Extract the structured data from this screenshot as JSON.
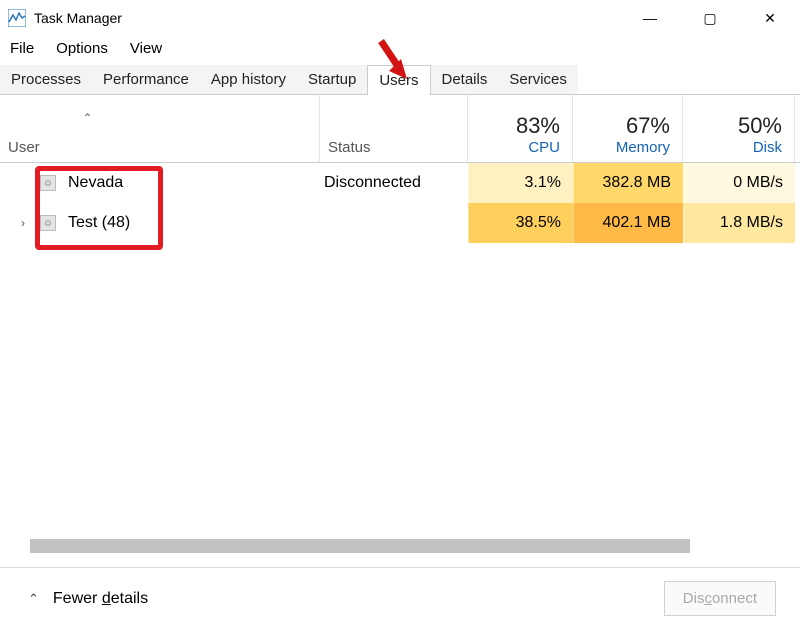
{
  "title": "Task Manager",
  "window_buttons": {
    "min": "—",
    "max": "▢",
    "close": "✕"
  },
  "menu": [
    "File",
    "Options",
    "View"
  ],
  "tabs": [
    "Processes",
    "Performance",
    "App history",
    "Startup",
    "Users",
    "Details",
    "Services"
  ],
  "active_tab": "Users",
  "columns": {
    "user": "User",
    "status": "Status",
    "cpu": {
      "percent": "83%",
      "label": "CPU"
    },
    "memory": {
      "percent": "67%",
      "label": "Memory"
    },
    "disk": {
      "percent": "50%",
      "label": "Disk"
    }
  },
  "rows": [
    {
      "expand": "",
      "name": "Nevada",
      "status": "Disconnected",
      "cpu": "3.1%",
      "memory": "382.8 MB",
      "disk": "0 MB/s",
      "cpu_class": "hc-y1",
      "mem_class": "hc-y2",
      "disk_class": "hc-y0"
    },
    {
      "expand": "›",
      "name": "Test (48)",
      "status": "",
      "cpu": "38.5%",
      "memory": "402.1 MB",
      "disk": "1.8 MB/s",
      "cpu_class": "hc-y3",
      "mem_class": "hc-o1",
      "disk_class": "hc-y4"
    }
  ],
  "footer": {
    "fewer_pre": "Fewer ",
    "fewer_u": "d",
    "fewer_post": "etails",
    "disc_pre": "Dis",
    "disc_u": "c",
    "disc_post": "onnect"
  }
}
